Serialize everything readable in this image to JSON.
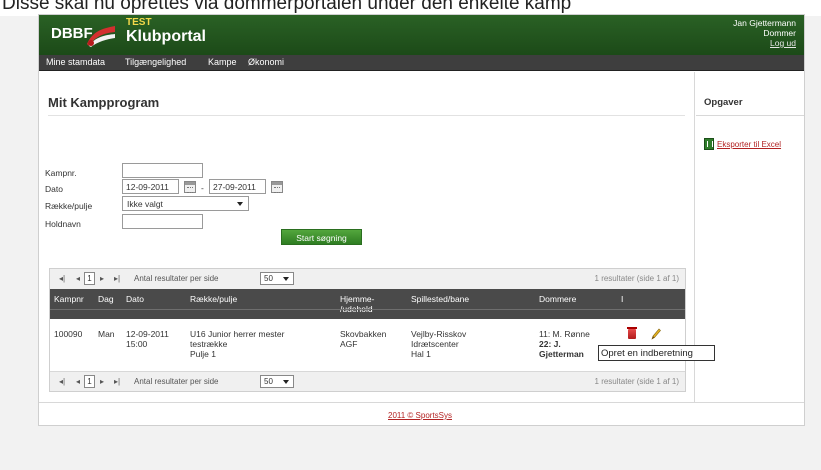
{
  "caption": "Disse skal nu oprettes via dommerportalen under den enkelte kamp",
  "header": {
    "org": "DBBF",
    "env_badge": "TEST",
    "app_name": "Klubportal",
    "user_name": "Jan Gjettermann",
    "user_role": "Dommer",
    "logout_label": "Log ud"
  },
  "nav": {
    "items": [
      "Mine stamdata",
      "Tilgængelighed",
      "Kampe",
      "Økonomi"
    ]
  },
  "main": {
    "title": "Mit Kampprogram",
    "form": {
      "kampnr_label": "Kampnr.",
      "kampnr_value": "",
      "dato_label": "Dato",
      "dato_from": "12-09-2011",
      "dato_sep": "-",
      "dato_to": "27-09-2011",
      "raekke_label": "Række/pulje",
      "raekke_value": "Ikke valgt",
      "holdnavn_label": "Holdnavn",
      "holdnavn_value": "",
      "search_button": "Start søgning"
    }
  },
  "grid": {
    "pager": {
      "first": "◂|",
      "prev": "◂",
      "page": "1",
      "next": "▸",
      "last": "▸|",
      "per_page_label": "Antal resultater per side",
      "per_page_value": "50",
      "summary": "1 resultater (side 1 af 1)"
    },
    "columns": [
      "Kampnr",
      "Dag",
      "Dato",
      "Række/pulje",
      "Hjemme-\n/udehold",
      "Spillested/bane",
      "Dommere",
      "I"
    ],
    "rows": [
      {
        "kampnr": "100090",
        "dag": "Man",
        "dato": "12-09-2011",
        "tid": "15:00",
        "raekke_1": "U16 Junior herrer mester",
        "raekke_2": "testrække",
        "raekke_3": "Pulje 1",
        "hold_1": "Skovbakken",
        "hold_2": "AGF",
        "sted_1": "Vejlby-Risskov",
        "sted_2": "Idrætscenter",
        "sted_3": "Hal 1",
        "dommer_1": "11: M. Rønne",
        "dommer_2": "22: J.",
        "dommer_3": "Gjetterman"
      }
    ],
    "tooltip": "Opret en indberetning"
  },
  "sidebar": {
    "title": "Opgaver",
    "export_label": "Eksporter til Excel"
  },
  "footer": {
    "copyright": "2011 © SportsSys"
  },
  "colors": {
    "header_green": "#1c4a18",
    "nav_dark": "#3e3e3e",
    "button_green": "#3e8f2e",
    "link_red": "#b22222",
    "table_header": "#4a4a4a"
  }
}
